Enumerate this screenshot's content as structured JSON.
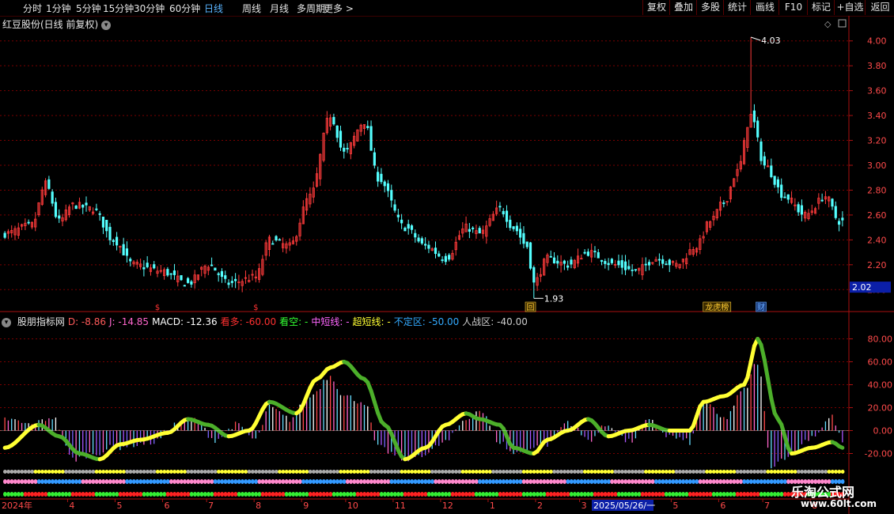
{
  "toolbar": {
    "periods": [
      "分时",
      "1分钟",
      "5分钟",
      "15分钟",
      "30分钟",
      "60分钟",
      "日线",
      "周线",
      "月线",
      "多周期",
      "更多 >"
    ],
    "active_period": "日线",
    "right_buttons": [
      "复权",
      "叠加",
      "多股",
      "统计",
      "画线",
      "F10",
      "标记",
      "+自选",
      "返回"
    ]
  },
  "stock_title": "红豆股份(日线 前复权)",
  "price_tag": "2.02",
  "indicator_bar": {
    "name": "股朋指标网",
    "items": [
      {
        "label": "D:",
        "value": "-8.86",
        "color": "#ff5a5a"
      },
      {
        "label": "J:",
        "value": "-14.85",
        "color": "#ff66cc"
      },
      {
        "label": "MACD:",
        "value": "-12.36",
        "color": "#ffffff"
      },
      {
        "label": "看多:",
        "value": "-60.00",
        "color": "#ff3030"
      },
      {
        "label": "看空:",
        "value": "-",
        "color": "#33ff33"
      },
      {
        "label": "中短线:",
        "value": "-",
        "color": "#ff66ff"
      },
      {
        "label": "超短线:",
        "value": "-",
        "color": "#ffff33"
      },
      {
        "label": "不定区:",
        "value": "-50.00",
        "color": "#33aaff"
      },
      {
        "label": "人战区:",
        "value": "-40.00",
        "color": "#cccccc"
      }
    ]
  },
  "markers": [
    {
      "text": "$",
      "color": "#ff3333",
      "x_index": 45
    },
    {
      "text": "$",
      "color": "#ff3333",
      "x_index": 74
    },
    {
      "text": "回",
      "color": "#ffcc33",
      "x_index": 155
    },
    {
      "text": "龙虎榜",
      "color": "#ffcc33",
      "x_index": 210
    },
    {
      "text": "财",
      "color": "#66aaff",
      "x_index": 223
    }
  ],
  "date_axis": {
    "start_label": "2024年",
    "labels": [
      "4",
      "5",
      "6",
      "7",
      "8",
      "9",
      "10",
      "11",
      "12",
      "1",
      "2",
      "3",
      "4",
      "5",
      "6",
      "7",
      "8",
      "9"
    ],
    "cursor_label": "2025/05/26/一"
  },
  "watermark": {
    "line1": "乐淘公式网",
    "line2": "www.60lt.com"
  },
  "colors": {
    "up": "#ff3b3b",
    "down": "#54ffff",
    "grid": "#7a0000",
    "axis": "#aa1111"
  },
  "chart_data": [
    {
      "type": "candlestick",
      "title": "红豆股份(日线 前复权)",
      "ylim": [
        1.9,
        4.1
      ],
      "yticks": [
        2.0,
        2.2,
        2.4,
        2.6,
        2.8,
        3.0,
        3.2,
        3.4,
        3.6,
        3.8,
        4.0
      ],
      "annotations": [
        {
          "text": "4.03",
          "value": 4.03
        },
        {
          "text": "1.93",
          "value": 1.93
        }
      ],
      "anchors_close": [
        [
          0,
          2.45
        ],
        [
          8,
          2.52
        ],
        [
          12,
          2.85
        ],
        [
          16,
          2.55
        ],
        [
          20,
          2.68
        ],
        [
          26,
          2.65
        ],
        [
          32,
          2.4
        ],
        [
          38,
          2.2
        ],
        [
          46,
          2.15
        ],
        [
          54,
          2.05
        ],
        [
          60,
          2.2
        ],
        [
          66,
          2.05
        ],
        [
          74,
          2.1
        ],
        [
          78,
          2.4
        ],
        [
          84,
          2.35
        ],
        [
          90,
          2.75
        ],
        [
          96,
          3.4
        ],
        [
          100,
          3.1
        ],
        [
          106,
          3.35
        ],
        [
          110,
          2.9
        ],
        [
          118,
          2.5
        ],
        [
          124,
          2.35
        ],
        [
          130,
          2.25
        ],
        [
          136,
          2.5
        ],
        [
          140,
          2.45
        ],
        [
          146,
          2.65
        ],
        [
          150,
          2.5
        ],
        [
          154,
          2.35
        ],
        [
          156,
          2.05
        ],
        [
          160,
          2.25
        ],
        [
          166,
          2.2
        ],
        [
          172,
          2.3
        ],
        [
          180,
          2.2
        ],
        [
          186,
          2.15
        ],
        [
          192,
          2.25
        ],
        [
          198,
          2.2
        ],
        [
          204,
          2.35
        ],
        [
          208,
          2.55
        ],
        [
          212,
          2.7
        ],
        [
          216,
          2.95
        ],
        [
          220,
          3.4
        ],
        [
          224,
          3.0
        ],
        [
          230,
          2.75
        ],
        [
          236,
          2.6
        ],
        [
          242,
          2.75
        ],
        [
          246,
          2.55
        ]
      ],
      "bars": 248
    },
    {
      "type": "line",
      "title": "股朋指标网",
      "ylim": [
        -30,
        90
      ],
      "yticks": [
        -20.0,
        0.0,
        20.0,
        40.0,
        60.0,
        80.0
      ],
      "series": [
        {
          "name": "MACD",
          "type": "histogram",
          "anchors": [
            [
              0,
              10
            ],
            [
              8,
              5
            ],
            [
              14,
              12
            ],
            [
              20,
              -25
            ],
            [
              26,
              -20
            ],
            [
              32,
              -15
            ],
            [
              38,
              -12
            ],
            [
              44,
              -10
            ],
            [
              50,
              5
            ],
            [
              56,
              10
            ],
            [
              62,
              -8
            ],
            [
              68,
              5
            ],
            [
              74,
              -8
            ],
            [
              78,
              20
            ],
            [
              84,
              10
            ],
            [
              90,
              30
            ],
            [
              96,
              48
            ],
            [
              100,
              30
            ],
            [
              106,
              25
            ],
            [
              110,
              -15
            ],
            [
              118,
              -25
            ],
            [
              124,
              -20
            ],
            [
              130,
              -10
            ],
            [
              136,
              10
            ],
            [
              140,
              18
            ],
            [
              146,
              -10
            ],
            [
              150,
              -20
            ],
            [
              156,
              -15
            ],
            [
              160,
              -12
            ],
            [
              166,
              8
            ],
            [
              172,
              -8
            ],
            [
              178,
              5
            ],
            [
              184,
              -10
            ],
            [
              190,
              8
            ],
            [
              196,
              -5
            ],
            [
              202,
              -10
            ],
            [
              206,
              25
            ],
            [
              212,
              10
            ],
            [
              218,
              35
            ],
            [
              222,
              60
            ],
            [
              226,
              -30
            ],
            [
              232,
              -20
            ],
            [
              238,
              -5
            ],
            [
              244,
              12
            ],
            [
              247,
              -10
            ]
          ]
        },
        {
          "name": "看多/看空",
          "type": "band",
          "anchors": [
            [
              0,
              -15
            ],
            [
              10,
              5
            ],
            [
              16,
              -5
            ],
            [
              22,
              -20
            ],
            [
              28,
              -25
            ],
            [
              34,
              -12
            ],
            [
              40,
              -8
            ],
            [
              48,
              -2
            ],
            [
              54,
              10
            ],
            [
              60,
              5
            ],
            [
              66,
              -5
            ],
            [
              72,
              0
            ],
            [
              78,
              25
            ],
            [
              86,
              15
            ],
            [
              92,
              45
            ],
            [
              96,
              55
            ],
            [
              100,
              60
            ],
            [
              106,
              45
            ],
            [
              112,
              5
            ],
            [
              118,
              -25
            ],
            [
              124,
              -15
            ],
            [
              130,
              5
            ],
            [
              136,
              15
            ],
            [
              140,
              10
            ],
            [
              146,
              5
            ],
            [
              150,
              -15
            ],
            [
              156,
              -20
            ],
            [
              160,
              -8
            ],
            [
              166,
              0
            ],
            [
              172,
              10
            ],
            [
              178,
              -5
            ],
            [
              184,
              0
            ],
            [
              190,
              5
            ],
            [
              196,
              0
            ],
            [
              202,
              0
            ],
            [
              206,
              25
            ],
            [
              212,
              30
            ],
            [
              218,
              40
            ],
            [
              222,
              80
            ],
            [
              228,
              10
            ],
            [
              232,
              -20
            ],
            [
              238,
              -15
            ],
            [
              244,
              -10
            ],
            [
              247,
              -15
            ]
          ]
        }
      ]
    }
  ]
}
